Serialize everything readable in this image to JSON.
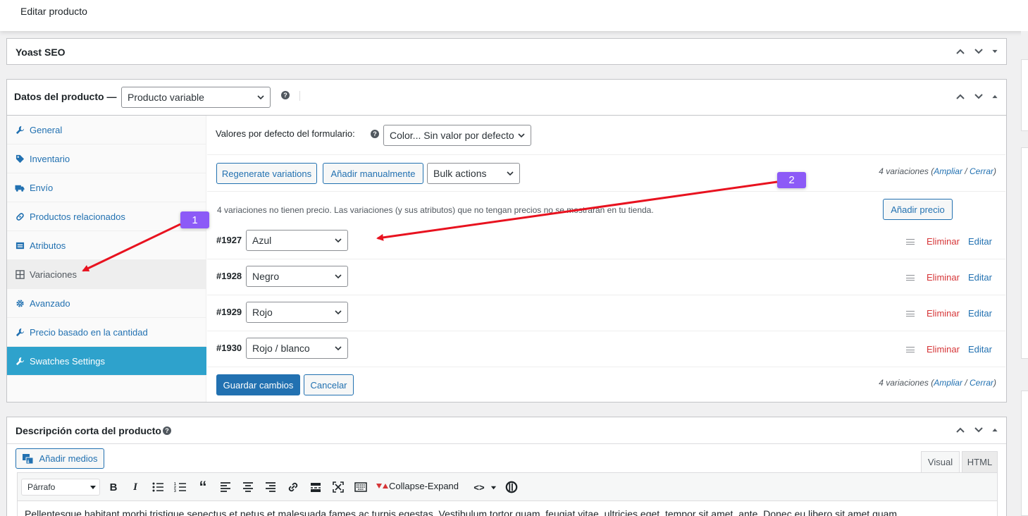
{
  "page": {
    "title": "Editar producto"
  },
  "yoast": {
    "title": "Yoast SEO"
  },
  "product_data": {
    "title": "Datos del producto —",
    "type_select": "Producto variable",
    "tabs": [
      {
        "label": "General",
        "icon": "wrench-icon"
      },
      {
        "label": "Inventario",
        "icon": "tag-icon"
      },
      {
        "label": "Envío",
        "icon": "truck-icon"
      },
      {
        "label": "Productos relacionados",
        "icon": "link-icon"
      },
      {
        "label": "Atributos",
        "icon": "list-icon"
      },
      {
        "label": "Variaciones",
        "icon": "grid-icon"
      },
      {
        "label": "Avanzado",
        "icon": "gear-icon"
      },
      {
        "label": "Precio basado en la cantidad",
        "icon": "wrench-icon"
      },
      {
        "label": "Swatches Settings",
        "icon": "wrench-icon"
      }
    ],
    "defaults_label": "Valores por defecto del formulario:",
    "defaults_select": "Color... Sin valor por defecto",
    "regenerate_btn": "Regenerate variations",
    "add_manual_btn": "Añadir manualmente",
    "bulk_select": "Bulk actions",
    "var_count_text": "4 variaciones",
    "expand_link": "Ampliar",
    "separator": "/",
    "close_link": "Cerrar",
    "notice": "4 variaciones no tienen precio. Las variaciones (y sus atributos) que no tengan precios no se mostrarán en tu tienda.",
    "add_price_btn": "Añadir precio",
    "variations": [
      {
        "id": "#1927",
        "value": "Azul"
      },
      {
        "id": "#1928",
        "value": "Negro"
      },
      {
        "id": "#1929",
        "value": "Rojo"
      },
      {
        "id": "#1930",
        "value": "Rojo / blanco"
      }
    ],
    "delete_label": "Eliminar",
    "edit_label": "Editar",
    "save_btn": "Guardar cambios",
    "cancel_btn": "Cancelar"
  },
  "short_desc": {
    "title": "Descripción corta del producto",
    "add_media_btn": "Añadir medios",
    "tab_visual": "Visual",
    "tab_html": "HTML",
    "format_select": "Párrafo",
    "collapse_label": "Collapse-Expand",
    "body_text": "Pellentesque habitant morbi tristique senectus et netus et malesuada fames ac turpis egestas. Vestibulum tortor quam, feugiat vitae, ultricies eget, tempor sit amet, ante. Donec eu libero sit amet quam"
  },
  "annotations": {
    "badge1": "1",
    "badge2": "2",
    "color": "#8c5af7",
    "arrow_color": "#e8121f"
  },
  "colors": {
    "accent": "#2271b1",
    "danger": "#d63638",
    "swatch_tab": "#2ea2cc"
  }
}
